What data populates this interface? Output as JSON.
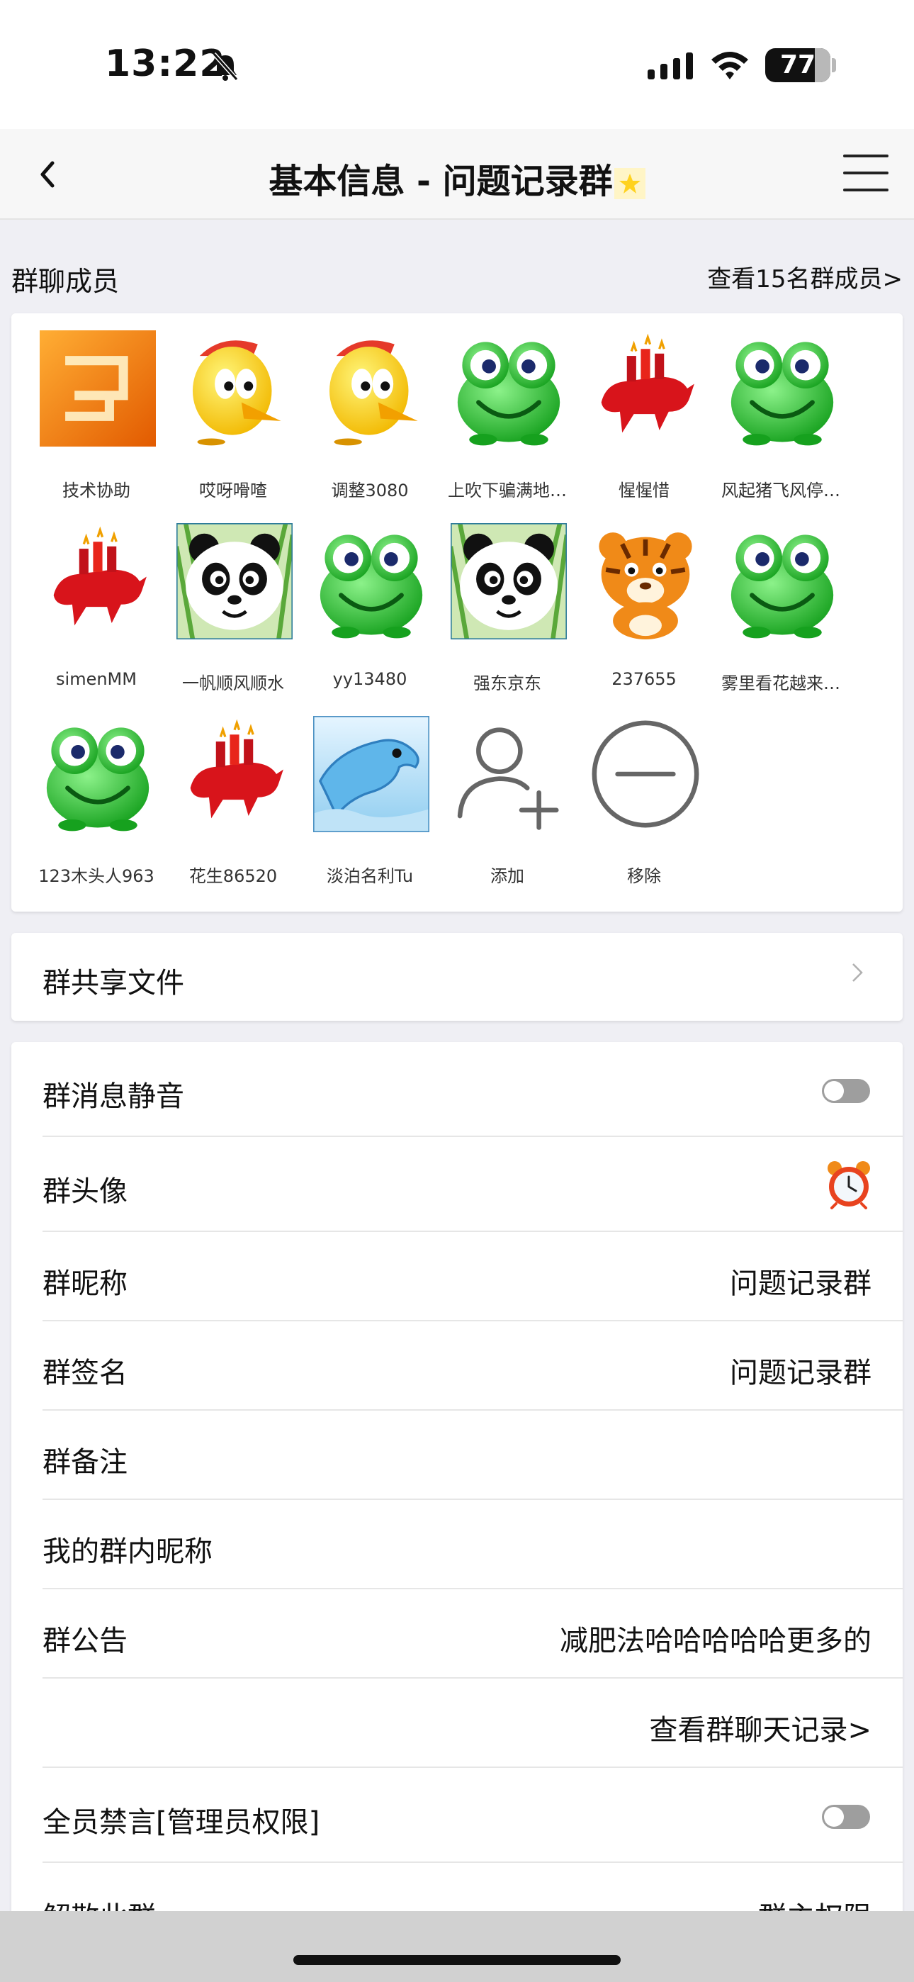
{
  "status_bar": {
    "time": "13:22",
    "battery": "77"
  },
  "nav": {
    "title": "基本信息 - 问题记录群"
  },
  "members": {
    "title": "群聊成员",
    "view_all": "查看15名群成员>",
    "items": [
      {
        "name": "技术协助",
        "icon": "orange-ma-tile-icon"
      },
      {
        "name": "哎呀嗗喳",
        "icon": "yellow-chick-icon"
      },
      {
        "name": "调整3080",
        "icon": "yellow-chick-icon"
      },
      {
        "name": "上吹下骗满地…",
        "icon": "green-frog-icon"
      },
      {
        "name": "惺惺惜",
        "icon": "red-bull-icon"
      },
      {
        "name": "风起猪飞风停…",
        "icon": "green-frog-icon"
      },
      {
        "name": "simenMM",
        "icon": "red-bull-icon"
      },
      {
        "name": "一帆顺风顺水",
        "icon": "panda-icon"
      },
      {
        "name": "yy13480",
        "icon": "green-frog-icon"
      },
      {
        "name": "强东京东",
        "icon": "panda-icon"
      },
      {
        "name": "237655",
        "icon": "tiger-icon"
      },
      {
        "name": "雾里看花越来…",
        "icon": "green-frog-icon"
      },
      {
        "name": "123木头人963",
        "icon": "green-frog-icon"
      },
      {
        "name": "花生86520",
        "icon": "red-bull-icon"
      },
      {
        "name": "淡泊名利Tu",
        "icon": "dolphin-icon"
      }
    ],
    "add_label": "添加",
    "remove_label": "移除"
  },
  "shared_files": {
    "label": "群共享文件"
  },
  "settings": {
    "mute": {
      "label": "群消息静音",
      "on": false
    },
    "avatar": {
      "label": "群头像",
      "icon": "alarm-clock-icon"
    },
    "nickname": {
      "label": "群昵称",
      "value": "问题记录群"
    },
    "signature": {
      "label": "群签名",
      "value": "问题记录群"
    },
    "remark": {
      "label": "群备注",
      "value": ""
    },
    "my_nickname": {
      "label": "我的群内昵称",
      "value": ""
    },
    "announcement": {
      "label": "群公告",
      "value": "减肥法哈哈哈哈哈更多的"
    },
    "history": {
      "value": "查看群聊天记录>"
    },
    "mute_all": {
      "label": "全员禁言[管理员权限]",
      "on": false
    },
    "dissolve": {
      "label": "解散此群",
      "value": "群主权限"
    }
  }
}
